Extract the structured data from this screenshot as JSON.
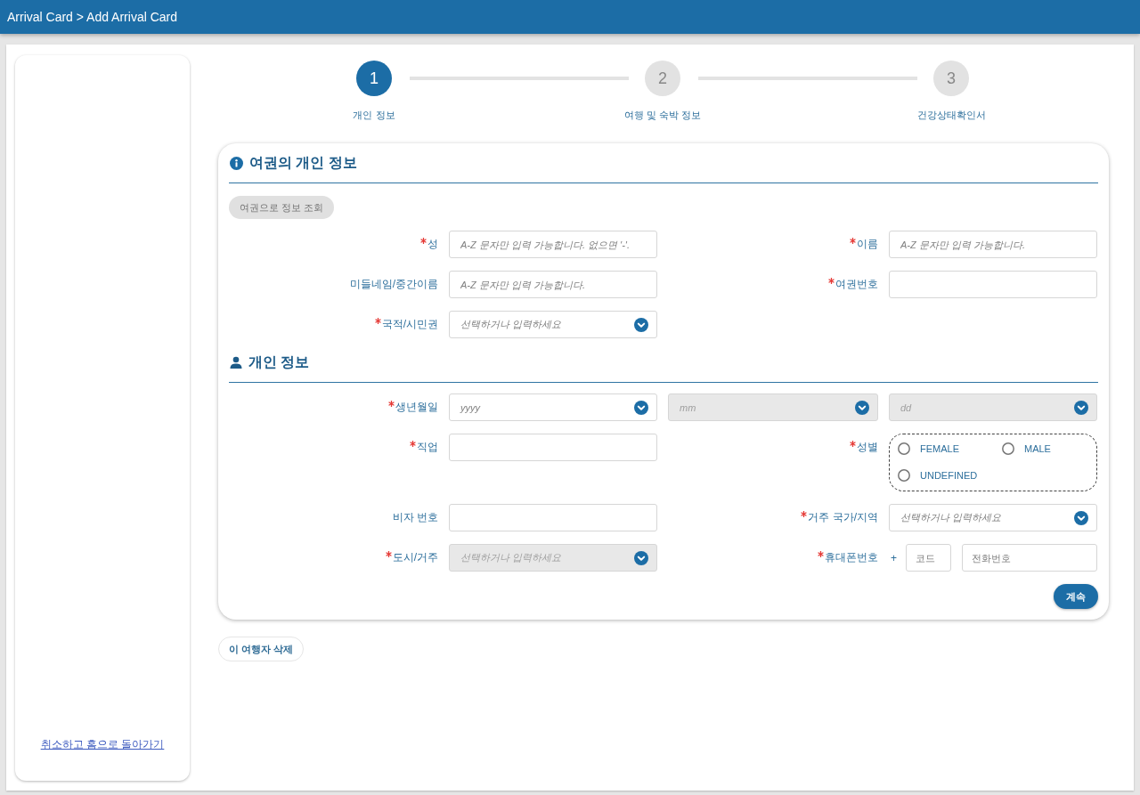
{
  "header": {
    "breadcrumb": "Arrival Card > Add Arrival Card"
  },
  "sidebar": {
    "cancel_link": "취소하고 홈으로 돌아가기"
  },
  "stepper": [
    {
      "number": "1",
      "label": "개인 정보",
      "selected": true
    },
    {
      "number": "2",
      "label": "여행 및 숙박 정보",
      "selected": false
    },
    {
      "number": "3",
      "label": "건강상태확인서",
      "selected": false
    }
  ],
  "sections": [
    {
      "kind": "passport",
      "title": "여권의 개인 정보",
      "lookup_button": "여권으로 정보 조회",
      "rows": [
        {
          "fields": [
            {
              "kind": "text",
              "label": "성",
              "required": true,
              "placeholder": "A-Z 문자만 입력 가능합니다. 없으면 '-'.",
              "disabled": false
            },
            {
              "kind": "text",
              "label": "이름",
              "required": true,
              "placeholder": "A-Z 문자만 입력 가능합니다.",
              "disabled": false
            }
          ]
        },
        {
          "fields": [
            {
              "kind": "text",
              "label": "미들네임/중간이름",
              "required": false,
              "placeholder": "A-Z 문자만 입력 가능합니다.",
              "disabled": false
            },
            {
              "kind": "text",
              "label": "여권번호",
              "required": true,
              "disabled": false
            }
          ]
        },
        {
          "fields": [
            {
              "kind": "select",
              "label": "국적/시민권",
              "required": true,
              "placeholder": "선택하거나 입력하세요",
              "disabled": false
            }
          ]
        }
      ]
    },
    {
      "kind": "personal",
      "title": "개인 정보",
      "rows": [
        {
          "fields": [
            {
              "kind": "date",
              "label": "생년월일",
              "required": true,
              "parts": [
                {
                  "placeholder": "yyyy",
                  "disabled": false
                },
                {
                  "placeholder": "mm",
                  "disabled": true
                },
                {
                  "placeholder": "dd",
                  "disabled": true
                }
              ]
            }
          ]
        },
        {
          "fields": [
            {
              "kind": "text",
              "label": "직업",
              "required": true,
              "disabled": false
            },
            {
              "kind": "radio",
              "label": "성별",
              "required": true,
              "options": [
                {
                  "label": "FEMALE",
                  "selected": false
                },
                {
                  "label": "MALE",
                  "selected": false
                },
                {
                  "label": "UNDEFINED",
                  "selected": false
                }
              ]
            }
          ]
        },
        {
          "fields": [
            {
              "kind": "text",
              "label": "비자 번호",
              "required": false,
              "disabled": false
            },
            {
              "kind": "select",
              "label": "거주 국가/지역",
              "required": true,
              "placeholder": "선택하거나 입력하세요",
              "disabled": false
            }
          ]
        },
        {
          "fields": [
            {
              "kind": "select",
              "label": "도시/거주",
              "required": true,
              "placeholder": "선택하거나 입력하세요",
              "disabled": true
            },
            {
              "kind": "phone",
              "label": "휴대폰번호",
              "required": true,
              "prefix": "+",
              "code_placeholder": "코드",
              "number_placeholder": "전화번호",
              "disabled": false
            }
          ]
        }
      ]
    }
  ],
  "continue_button": "계속",
  "delete_button": "이 여행자 삭제"
}
